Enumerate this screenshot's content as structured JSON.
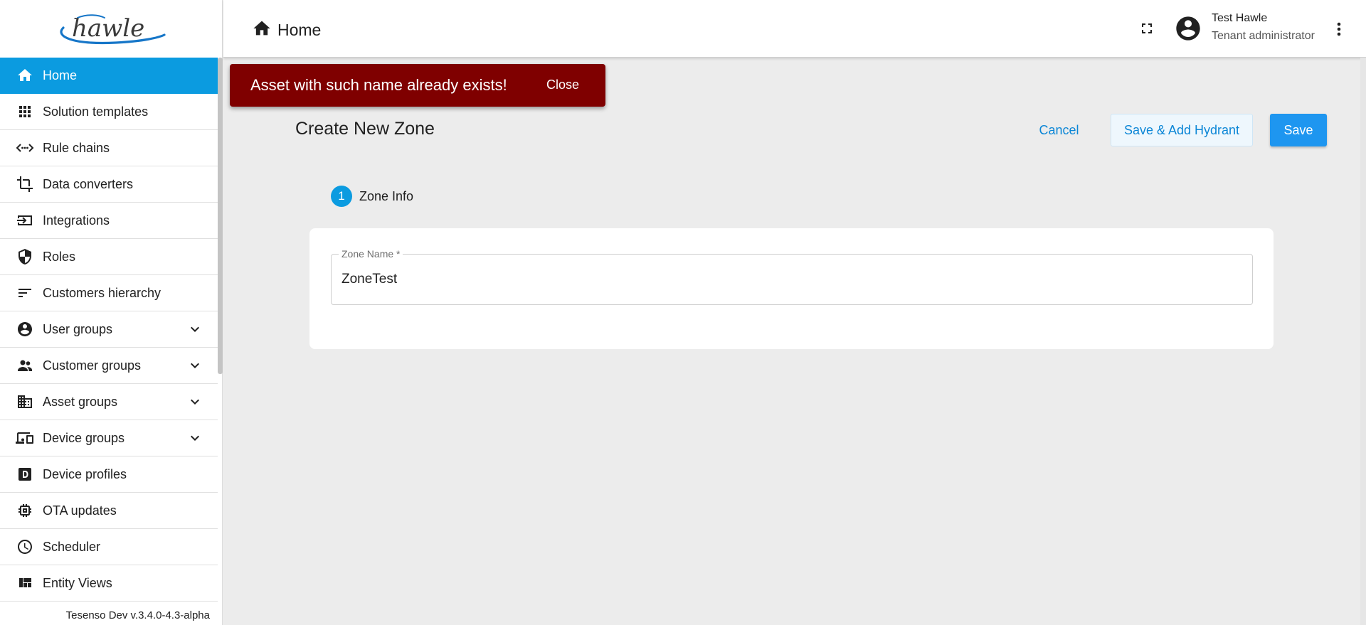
{
  "colors": {
    "accent": "#0b9be0",
    "toast_bg": "#7f0000",
    "primary_button": "#1e96f0",
    "link": "#0b86d6"
  },
  "logo": {
    "text": "hawle"
  },
  "sidebar": {
    "items": [
      {
        "label": "Home",
        "icon": "home-icon",
        "active": true,
        "expandable": false
      },
      {
        "label": "Solution templates",
        "icon": "grid-icon",
        "expandable": false
      },
      {
        "label": "Rule chains",
        "icon": "code-arrows-icon",
        "expandable": false
      },
      {
        "label": "Data converters",
        "icon": "crop-icon",
        "expandable": false
      },
      {
        "label": "Integrations",
        "icon": "input-icon",
        "expandable": false
      },
      {
        "label": "Roles",
        "icon": "shield-icon",
        "expandable": false
      },
      {
        "label": "Customers hierarchy",
        "icon": "sort-icon",
        "expandable": false
      },
      {
        "label": "User groups",
        "icon": "account-circle-icon",
        "expandable": true
      },
      {
        "label": "Customer groups",
        "icon": "people-icon",
        "expandable": true
      },
      {
        "label": "Asset groups",
        "icon": "building-icon",
        "expandable": true
      },
      {
        "label": "Device groups",
        "icon": "devices-icon",
        "expandable": true
      },
      {
        "label": "Device profiles",
        "icon": "device-profile-icon",
        "expandable": false
      },
      {
        "label": "OTA updates",
        "icon": "chip-icon",
        "expandable": false
      },
      {
        "label": "Scheduler",
        "icon": "clock-icon",
        "expandable": false
      },
      {
        "label": "Entity Views",
        "icon": "view-quilt-icon",
        "expandable": false
      }
    ],
    "version": "Tesenso Dev v.3.4.0-4.3-alpha"
  },
  "header": {
    "breadcrumb": "Home",
    "user": {
      "name": "Test Hawle",
      "role": "Tenant administrator"
    }
  },
  "toast": {
    "message": "Asset with such name already exists!",
    "close_label": "Close"
  },
  "main": {
    "title": "Create New Zone",
    "buttons": {
      "cancel": "Cancel",
      "save_add": "Save & Add Hydrant",
      "save": "Save"
    },
    "step": {
      "number": "1",
      "label": "Zone Info"
    },
    "field": {
      "label": "Zone Name *",
      "value": "ZoneTest"
    }
  }
}
